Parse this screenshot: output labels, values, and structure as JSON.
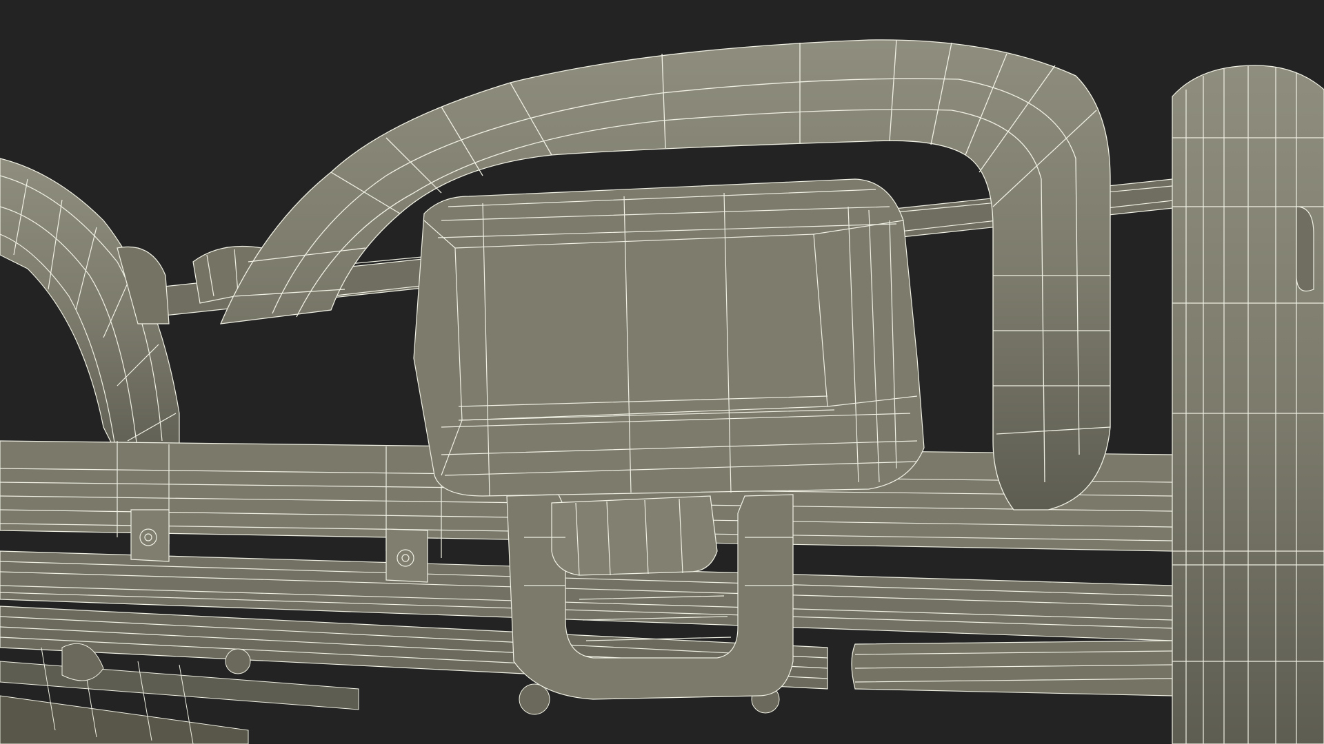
{
  "scene": {
    "subject": "wireframe-3d-model",
    "colors": {
      "background": "#232323",
      "surface": "#7c7b6c",
      "surface_shadow": "#5f5e53",
      "surface_light": "#8e8d7d",
      "wire": "#f0f0e4"
    }
  }
}
